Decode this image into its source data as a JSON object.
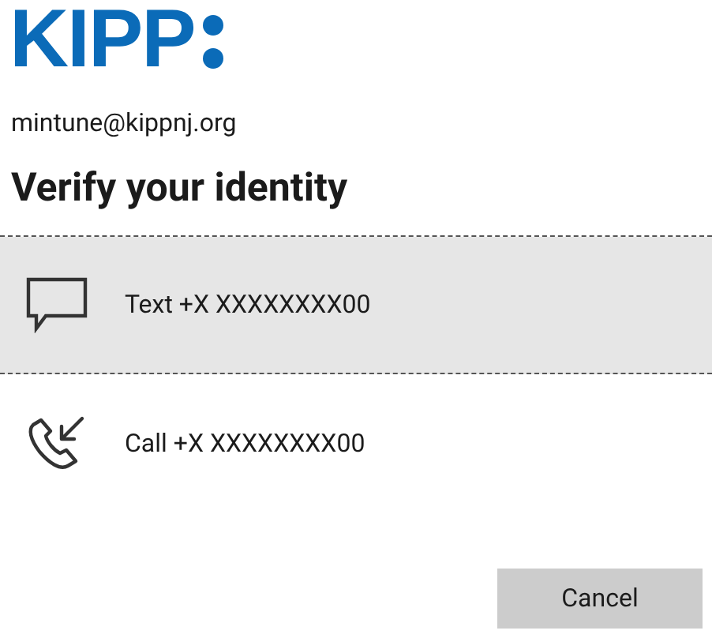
{
  "logo": {
    "text": "KIPP"
  },
  "account": {
    "email": "mintune@kippnj.org"
  },
  "title": "Verify your identity",
  "options": [
    {
      "kind": "text",
      "label": "Text +X XXXXXXXX00",
      "selected": true
    },
    {
      "kind": "call",
      "label": "Call +X XXXXXXXX00",
      "selected": false
    }
  ],
  "buttons": [
    "Cancel"
  ]
}
